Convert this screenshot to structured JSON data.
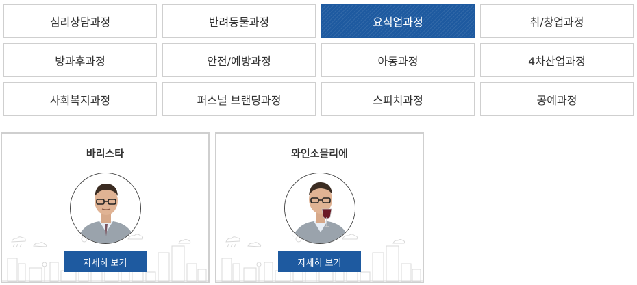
{
  "categories": [
    {
      "label": "심리상담과정",
      "active": false
    },
    {
      "label": "반려동물과정",
      "active": false
    },
    {
      "label": "요식업과정",
      "active": true
    },
    {
      "label": "취/창업과정",
      "active": false
    },
    {
      "label": "방과후과정",
      "active": false
    },
    {
      "label": "안전/예방과정",
      "active": false
    },
    {
      "label": "아동과정",
      "active": false
    },
    {
      "label": "4차산업과정",
      "active": false
    },
    {
      "label": "사회복지과정",
      "active": false
    },
    {
      "label": "퍼스널 브랜딩과정",
      "active": false
    },
    {
      "label": "스피치과정",
      "active": false
    },
    {
      "label": "공예과정",
      "active": false
    }
  ],
  "courses": [
    {
      "title": "바리스타",
      "button": "자세히 보기"
    },
    {
      "title": "와인소믈리에",
      "button": "자세히 보기"
    }
  ],
  "colors": {
    "accent": "#1e5aa0",
    "border": "#cfcfcf",
    "text": "#333333"
  }
}
